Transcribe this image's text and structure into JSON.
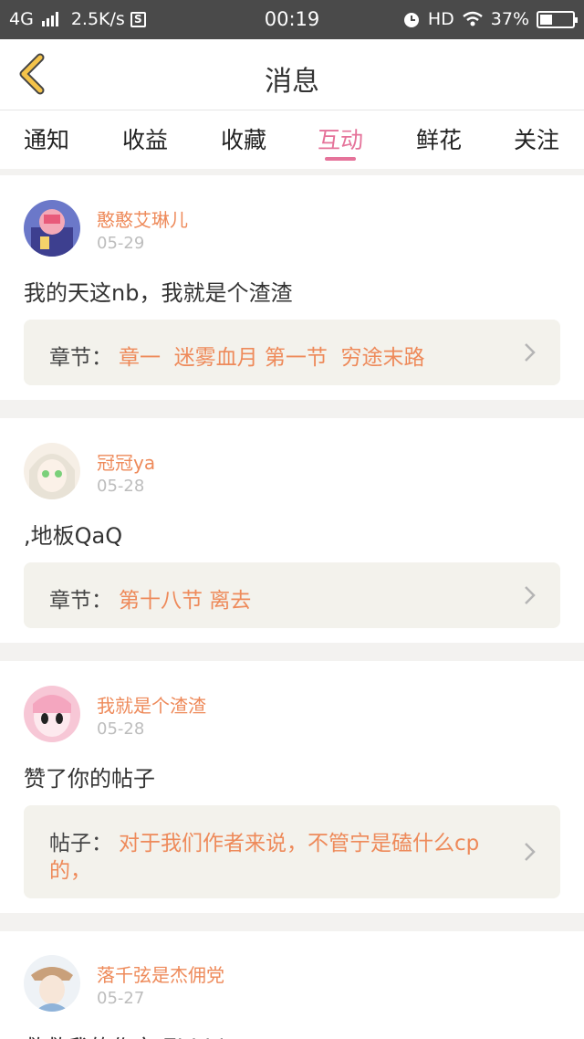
{
  "status_bar": {
    "network": "4G",
    "speed": "2.5K/s",
    "s_badge": "S",
    "time": "00:19",
    "hd": "HD",
    "battery": "37%"
  },
  "header": {
    "title": "消息"
  },
  "tabs": [
    {
      "label": "通知"
    },
    {
      "label": "收益"
    },
    {
      "label": "收藏"
    },
    {
      "label": "互动",
      "active": true
    },
    {
      "label": "鲜花"
    },
    {
      "label": "关注"
    }
  ],
  "messages": [
    {
      "user": "憨憨艾琳儿",
      "date": "05-29",
      "content": "我的天这nb，我就是个渣渣",
      "ref_label": "章节：",
      "ref_text": "章一  迷雾血月 第一节  穷途末路"
    },
    {
      "user": "冠冠ya",
      "date": "05-28",
      "content": ",地板QaQ",
      "ref_label": "章节：",
      "ref_text": "第十八节 离去"
    },
    {
      "user": "我就是个渣渣",
      "date": "05-28",
      "content": "赞了你的帖子",
      "ref_label": "帖子：",
      "ref_text_line1": "对于我们作者来说，不管宁是磕什么cp",
      "ref_text_line2": "的，"
    },
    {
      "user": "落千弦是杰佣党",
      "date": "05-27",
      "content": "救救我的作文吧hhhh"
    }
  ],
  "colors": {
    "accent": "#e5739a",
    "username": "#ee8a5a",
    "back_arrow": "#f4c34a"
  }
}
